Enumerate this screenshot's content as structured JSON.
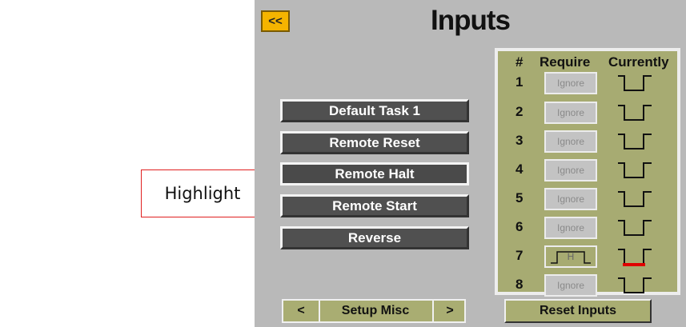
{
  "callout": {
    "label": "Highlight"
  },
  "header": {
    "back_label": "<<",
    "title": "Inputs"
  },
  "task_buttons": [
    {
      "label": "Default Task 1"
    },
    {
      "label": "Remote Reset"
    },
    {
      "label": "Remote Halt",
      "highlighted": true
    },
    {
      "label": "Remote Start"
    },
    {
      "label": "Reverse"
    }
  ],
  "inputs_table": {
    "headers": {
      "number": "#",
      "require": "Require",
      "currently": "Currently"
    },
    "rows": [
      {
        "number": "1",
        "require": "Ignore",
        "current_state": "low"
      },
      {
        "number": "2",
        "require": "Ignore",
        "current_state": "low"
      },
      {
        "number": "3",
        "require": "Ignore",
        "current_state": "low"
      },
      {
        "number": "4",
        "require": "Ignore",
        "current_state": "low"
      },
      {
        "number": "5",
        "require": "Ignore",
        "current_state": "low"
      },
      {
        "number": "6",
        "require": "Ignore",
        "current_state": "low"
      },
      {
        "number": "7",
        "require": "H",
        "require_icon": "high-pulse-icon",
        "current_state": "low-mismatch"
      },
      {
        "number": "8",
        "require": "Ignore",
        "current_state": "low"
      }
    ]
  },
  "footer": {
    "prev_label": "<",
    "section_label": "Setup Misc",
    "next_label": ">",
    "reset_label": "Reset Inputs"
  },
  "colors": {
    "panel": "#b9b9b9",
    "accent_yellow": "#f5b400",
    "table_olive": "#a7ab72",
    "button_dark": "#505050",
    "mismatch_red": "#e00000",
    "callout_red": "#e02020"
  }
}
